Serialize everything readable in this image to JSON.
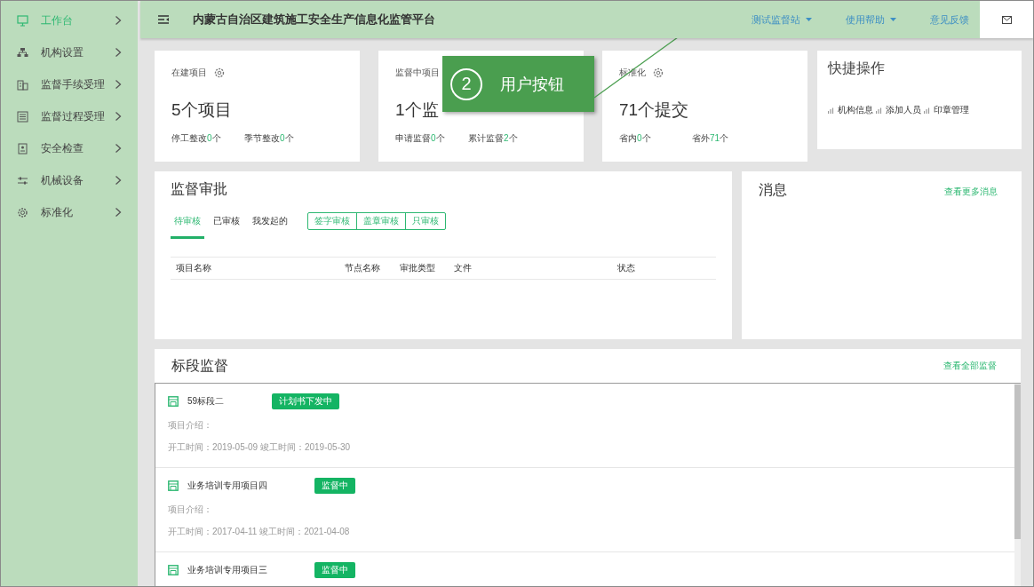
{
  "sidebar": {
    "items": [
      {
        "label": "工作台",
        "selected": true
      },
      {
        "label": "机构设置",
        "selected": false
      },
      {
        "label": "监督手续受理",
        "selected": false
      },
      {
        "label": "监督过程受理",
        "selected": false
      },
      {
        "label": "安全检查",
        "selected": false
      },
      {
        "label": "机械设备",
        "selected": false
      },
      {
        "label": "标准化",
        "selected": false
      }
    ]
  },
  "topbar": {
    "title": "内蒙古自治区建筑施工安全生产信息化监管平台",
    "menu": [
      {
        "label": "测试监督站",
        "kind": "dropdown"
      },
      {
        "label": "使用帮助",
        "kind": "dropdown"
      },
      {
        "label": "意见反馈",
        "kind": "link"
      }
    ]
  },
  "stat_cards": [
    {
      "label": "在建项目",
      "gear": true,
      "value": "5个项目",
      "stats": [
        {
          "label": "停工整改",
          "count": "0",
          "unit": "个"
        },
        {
          "label": "季节整改",
          "count": "0",
          "unit": "个"
        }
      ]
    },
    {
      "label": "监督中项目",
      "value": "1个监",
      "stats": [
        {
          "label": "申请监督",
          "count": "0",
          "unit": "个"
        },
        {
          "label": "累计监督",
          "count": "2",
          "unit": "个"
        }
      ]
    },
    {
      "label": "标准化",
      "gear": true,
      "value": "71个提交",
      "stats": [
        {
          "label": "省内",
          "count": "0",
          "unit": "个"
        },
        {
          "label": "省外",
          "count": "71",
          "unit": "个"
        }
      ]
    }
  ],
  "quick_actions": {
    "title": "快捷操作",
    "items": [
      "机构信息",
      "添加人员",
      "印章管理"
    ]
  },
  "approval": {
    "title": "监督审批",
    "tabs": [
      {
        "label": "待审核",
        "selected": true
      },
      {
        "label": "已审核",
        "selected": false
      },
      {
        "label": "我发起的",
        "selected": false
      }
    ],
    "filters": [
      {
        "label": "签字审核",
        "selected": false
      },
      {
        "label": "盖章审核",
        "selected": false
      },
      {
        "label": "只审核",
        "selected": false
      }
    ],
    "columns": [
      "项目名称",
      "节点名称",
      "审批类型",
      "文件",
      "状态"
    ]
  },
  "messages": {
    "title": "消息",
    "link": "查看更多消息"
  },
  "sections": {
    "title": "标段监督",
    "link": "查看全部监督",
    "items": [
      {
        "name": "59标段二",
        "status": "计划书下发中",
        "intro": "项目介绍：",
        "dates": "开工时间：2019-05-09 竣工时间：2019-05-30"
      },
      {
        "name": "业务培训专用项目四",
        "status": "监督中",
        "intro": "项目介绍：",
        "dates": "开工时间：2017-04-11 竣工时间：2021-04-08"
      },
      {
        "name": "业务培训专用项目三",
        "status": "监督中"
      }
    ]
  },
  "callout": {
    "number": "2",
    "text": "用户按钮"
  }
}
